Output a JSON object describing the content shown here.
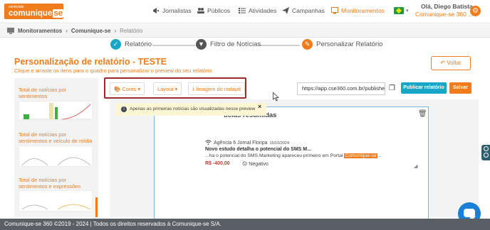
{
  "brand": {
    "tagline": "conéctate",
    "name_main": "comunique",
    "name_suffix": "se",
    "accent": "#f07c1e"
  },
  "nav": {
    "items": [
      {
        "label": "Jornalistas",
        "icon": "megaphone-icon"
      },
      {
        "label": "Públicos",
        "icon": "users-icon"
      },
      {
        "label": "Atividades",
        "icon": "list-icon"
      },
      {
        "label": "Campanhas",
        "icon": "paper-plane-icon"
      },
      {
        "label": "Monitoramentos",
        "icon": "monitor-icon",
        "active": true
      }
    ]
  },
  "user": {
    "greeting": "Olá, Diego Batista",
    "org": "Comunique-se 360 ..."
  },
  "breadcrumb": {
    "items": [
      "Monitoramentos",
      "Comunique-se",
      "Relatório"
    ]
  },
  "steps": [
    {
      "label": "Relatório",
      "icon": "check-icon",
      "state": "done"
    },
    {
      "label": "Filtro de Notícias",
      "icon": "filter-icon",
      "state": "pending"
    },
    {
      "label": "Personalizar Relatório",
      "icon": "pencil-icon",
      "state": "active"
    }
  ],
  "page": {
    "title": "Personalização de relatório - TESTE",
    "subtitle": "Clique e arraste os itens para o quadro para personalizar o preview do seu relatório",
    "back_label": "Voltar"
  },
  "widgets": [
    {
      "title_line1": "Total de notícias por",
      "title_line2": "sentimentos"
    },
    {
      "title_line1": "Total de notícias por",
      "title_line2": "sentimentos e veículo de mídia"
    },
    {
      "title_line1": "Total de notícias por",
      "title_line2": "sentimentos e expressões"
    }
  ],
  "toolbar": {
    "colors_label": "Cores",
    "layout_label": "Layout",
    "footer_image_label": "Imagem do rodapé",
    "url_value": "https://app.cse360.com.br/published",
    "publish_label": "Publicar relatório",
    "save_label": "Salvar"
  },
  "tooltip": {
    "text": "Apenas as primeiras notícias são visualizadas nesse preview",
    "close": "×"
  },
  "card": {
    "title": "ticias resumidas",
    "news": {
      "source": "Agência 6 Jornal Floripa",
      "date": "15/10/2024",
      "headline": "Novo estudo detalha o potencial do SMS M...",
      "snippet_before": "...ha o potencial do SMS Marketing apareceu primeiro em Portal ",
      "snippet_highlight": "Comunique-se",
      "snippet_after": "...",
      "value": "R$ -400,00",
      "sentiment": "Negativo"
    }
  },
  "footer": {
    "text": "Comunique-se 360 ©2019 - 2024 | Todos os direitos reservados à Comunique-se S/A."
  }
}
